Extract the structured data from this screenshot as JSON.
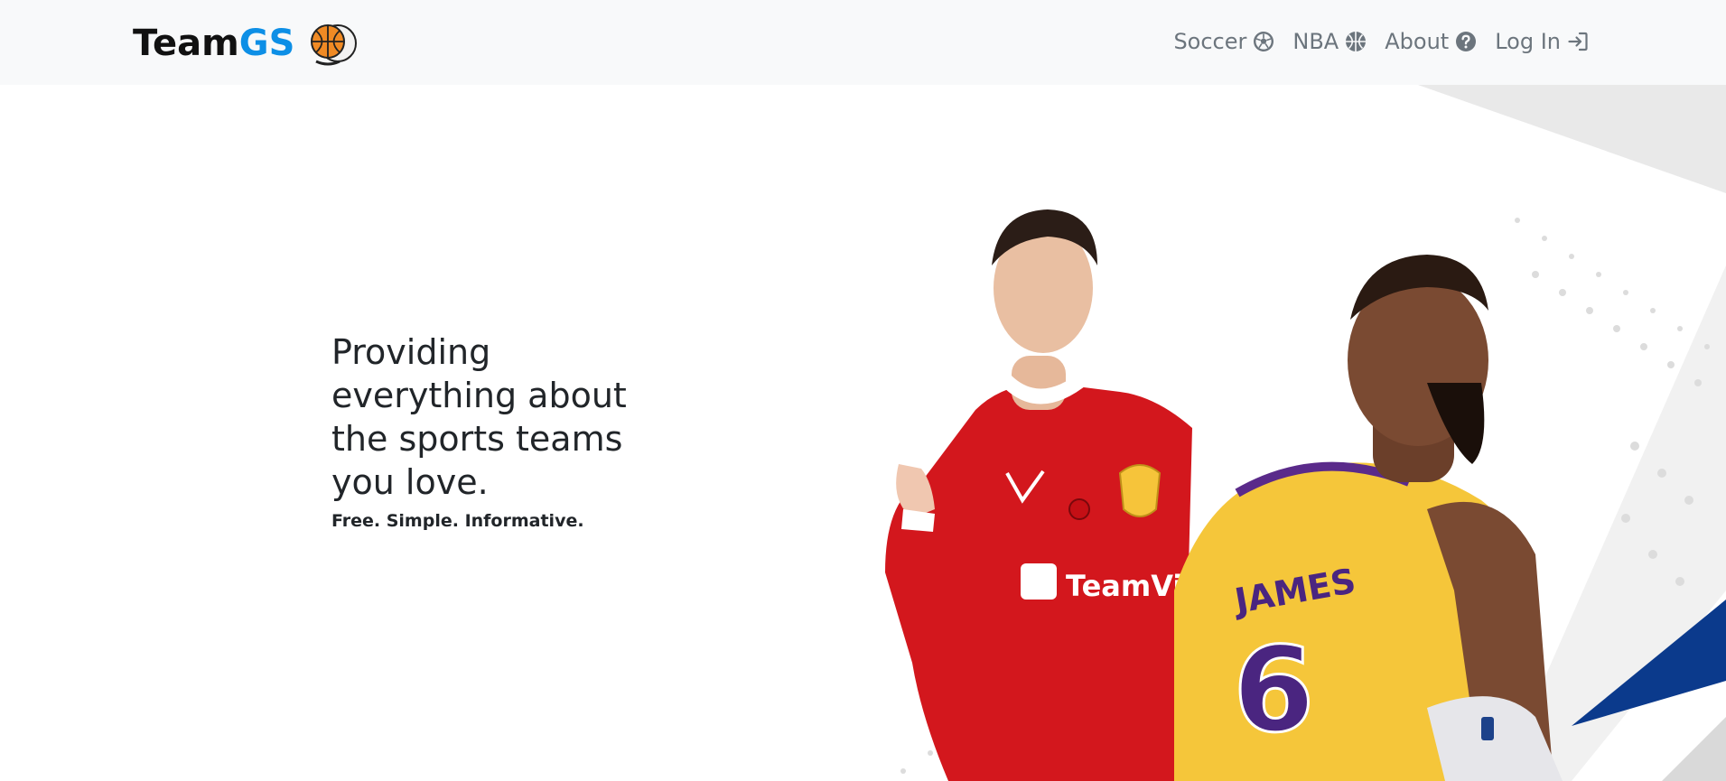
{
  "brand": {
    "name_part1": "Team",
    "name_part2": "GS",
    "logo_icon": "basketball-soccer-logo"
  },
  "colors": {
    "navbar_bg": "#f8f9fa",
    "brand_accent": "#0d8fe6",
    "nav_link": "#6c757d",
    "jersey_red": "#d3171d",
    "jersey_gold": "#f5c63a",
    "accent_blue": "#0b3a8c"
  },
  "nav": {
    "items": [
      {
        "label": "Soccer",
        "icon": "soccer-ball-icon"
      },
      {
        "label": "NBA",
        "icon": "basketball-icon"
      },
      {
        "label": "About",
        "icon": "question-circle-icon"
      },
      {
        "label": "Log In",
        "icon": "login-arrow-icon"
      }
    ]
  },
  "hero": {
    "title": "Providing everything about the sports teams you love.",
    "subtitle": "Free. Simple. Informative.",
    "jersey_sponsor": "TeamViewer",
    "jersey_name": "JAMES",
    "jersey_number": "6"
  }
}
